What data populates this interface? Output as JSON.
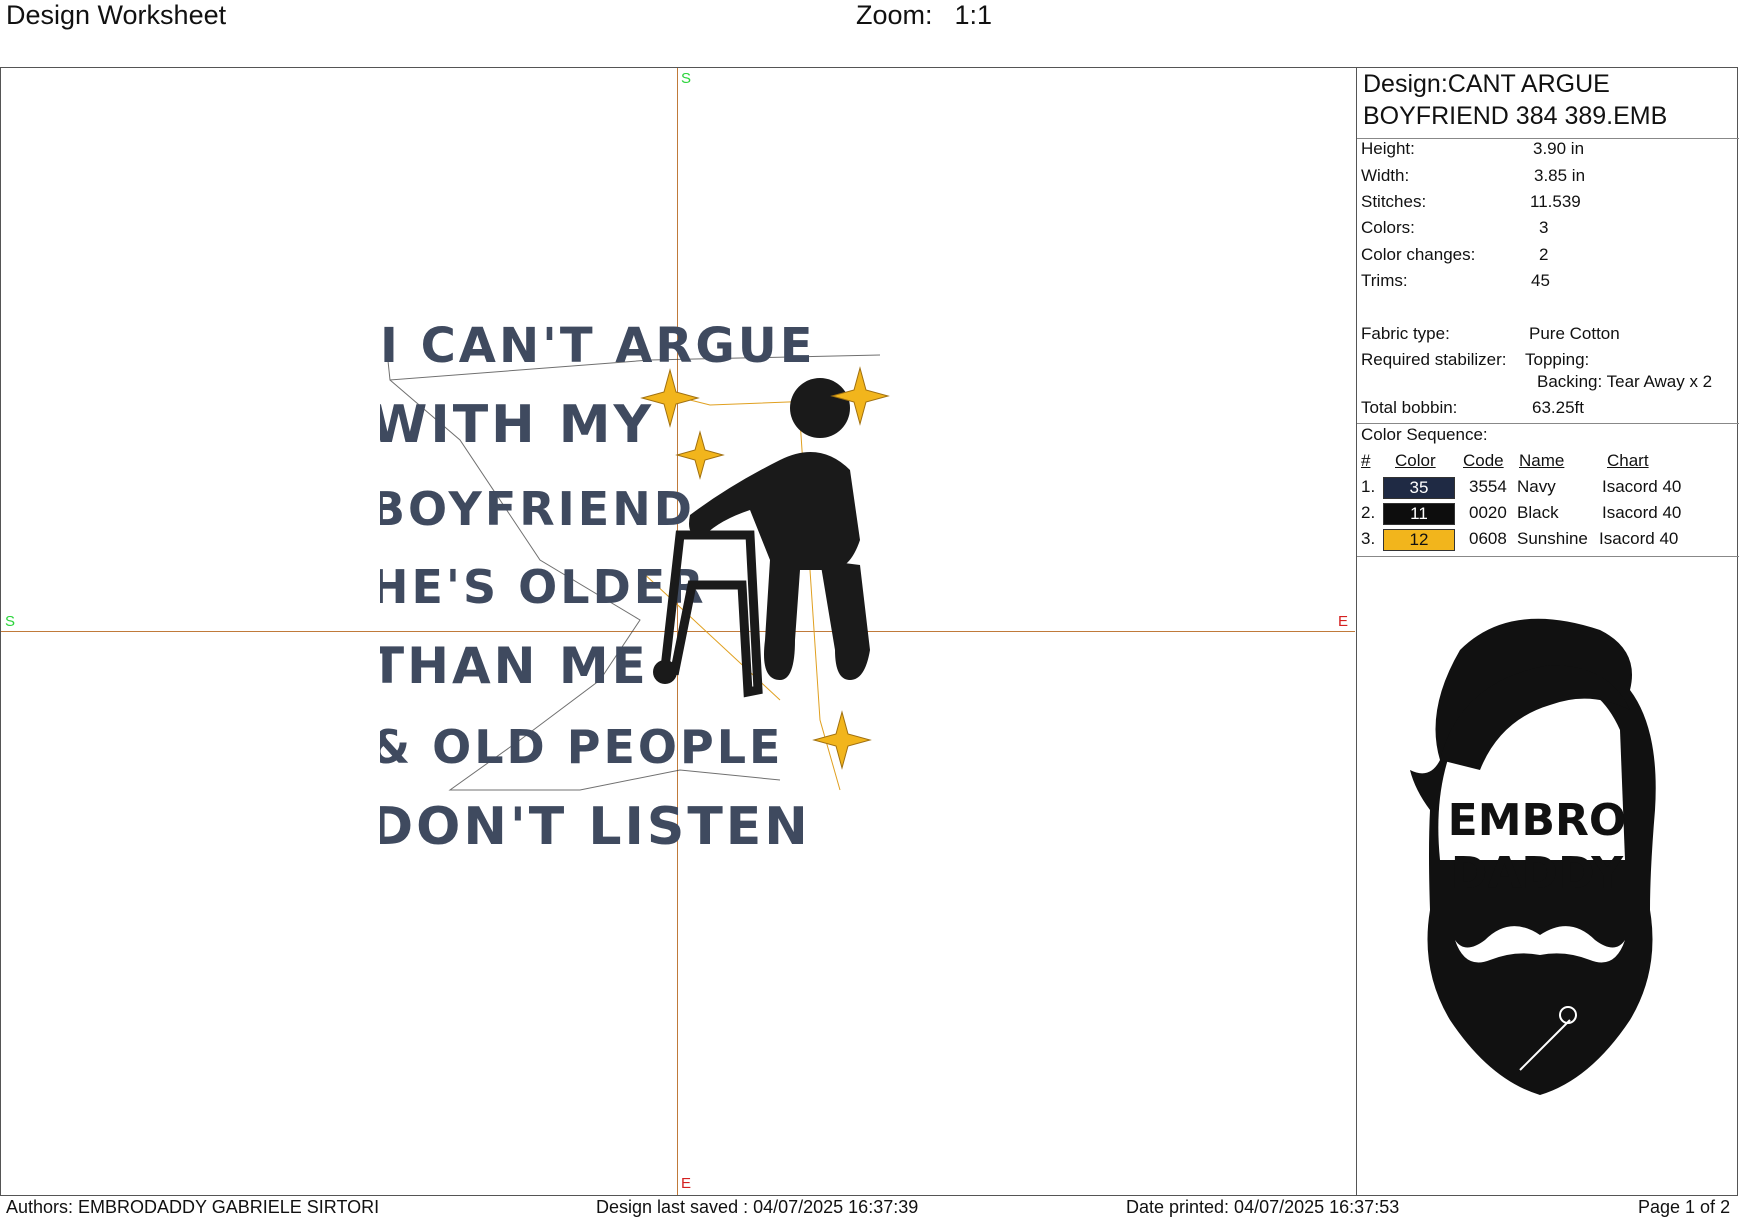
{
  "header": {
    "title": "Design Worksheet",
    "zoom_label": "Zoom:",
    "zoom_value": "1:1"
  },
  "canvas": {
    "marks": {
      "top": "S",
      "left": "S",
      "right": "E",
      "bottom": "E"
    }
  },
  "design_text": {
    "lines": [
      "I CAN'T ARGUE",
      "WITH MY",
      "BOYFRIEND",
      "HE'S OLDER",
      "THAN ME",
      "& OLD PEOPLE",
      "DON'T LISTEN"
    ]
  },
  "panel": {
    "design_title": "Design:CANT ARGUE BOYFRIEND 384 389.EMB",
    "stats": [
      {
        "label": "Height:",
        "value": "3.90 in"
      },
      {
        "label": "Width:",
        "value": "3.85 in"
      },
      {
        "label": "Stitches:",
        "value": "11.539"
      },
      {
        "label": "Colors:",
        "value": "3"
      },
      {
        "label": "Color changes:",
        "value": "2"
      },
      {
        "label": "Trims:",
        "value": "45"
      }
    ],
    "fabric": {
      "label": "Fabric type:",
      "value": "Pure Cotton"
    },
    "stabilizer": {
      "label": "Required stabilizer:",
      "topping": "Topping:",
      "backing": "Backing: Tear Away x 2"
    },
    "bobbin": {
      "label": "Total bobbin:",
      "value": "63.25ft"
    },
    "color_sequence": {
      "title": "Color Sequence:",
      "headers": {
        "num": "#",
        "color": "Color",
        "code": "Code",
        "name": "Name",
        "chart": "Chart"
      },
      "rows": [
        {
          "num": "1.",
          "swatch": "35",
          "hex": "#1f2a44",
          "text_color": "#ffffff",
          "code": "3554",
          "name": "Navy",
          "chart": "Isacord 40"
        },
        {
          "num": "2.",
          "swatch": "11",
          "hex": "#0d0d0d",
          "text_color": "#ffffff",
          "code": "0020",
          "name": "Black",
          "chart": "Isacord 40"
        },
        {
          "num": "3.",
          "swatch": "12",
          "hex": "#f2b51c",
          "text_color": "#111111",
          "code": "0608",
          "name": "Sunshine",
          "chart": "Isacord 40"
        }
      ]
    },
    "logo": {
      "line1": "EMBRO",
      "line2": "DADDY"
    }
  },
  "footer": {
    "authors": "Authors: EMBRODADDY GABRIELE SIRTORI",
    "saved": "Design last saved : 04/07/2025 16:37:39",
    "printed": "Date printed: 04/07/2025 16:37:53",
    "page": "Page 1 of 2"
  },
  "colors": {
    "guide_line": "#c07a3a",
    "start_mark": "#2bd43b",
    "end_mark": "#d42020",
    "star": "#f2b51c",
    "navy": "#3f4a5f"
  }
}
